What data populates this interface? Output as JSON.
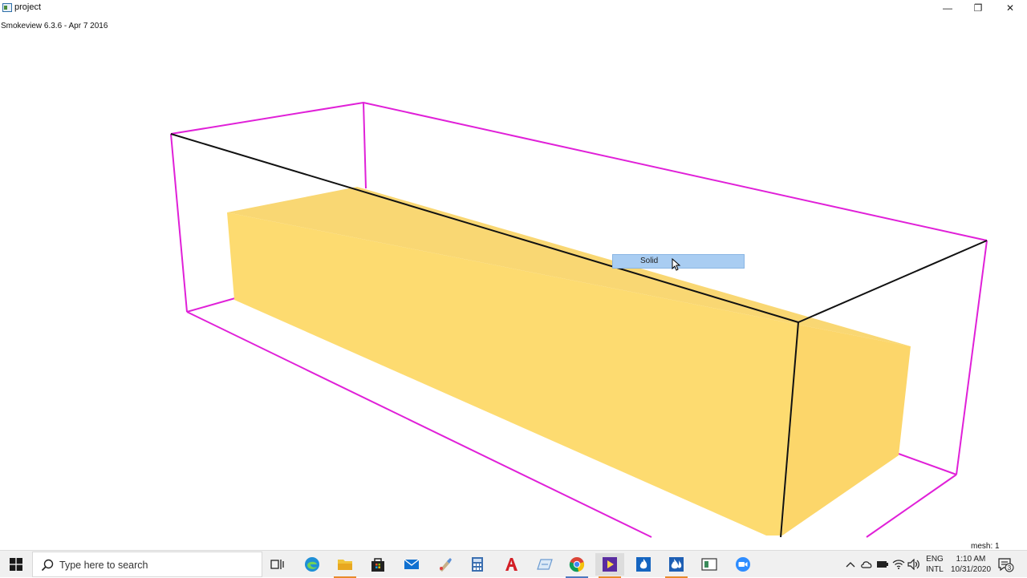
{
  "window": {
    "title": "project",
    "minimize_glyph": "—",
    "maximize_glyph": "❐",
    "close_glyph": "✕"
  },
  "viewer": {
    "version_label": "Smokeview 6.3.6 - Apr  7 2016",
    "mesh_label": "mesh: 1",
    "tooltip_text": "Solid",
    "colors": {
      "domain_outline": "#e020d8",
      "edge_line": "#111111",
      "solid_top": "#f9d773",
      "solid_front": "#fddb70",
      "solid_side": "#fcd66a"
    }
  },
  "taskbar": {
    "search_placeholder": "Type here to search",
    "pinned": [
      {
        "name": "task-view-icon"
      },
      {
        "name": "edge-icon"
      },
      {
        "name": "file-explorer-icon"
      },
      {
        "name": "store-icon"
      },
      {
        "name": "mail-icon"
      },
      {
        "name": "paint-icon"
      },
      {
        "name": "calculator-icon"
      },
      {
        "name": "autocad-icon"
      },
      {
        "name": "snip-icon"
      },
      {
        "name": "chrome-icon"
      },
      {
        "name": "media-player-icon"
      },
      {
        "name": "pyrosim-icon"
      },
      {
        "name": "smokeview-icon"
      },
      {
        "name": "window-app-icon"
      },
      {
        "name": "zoom-icon"
      }
    ],
    "tray": {
      "lang_line1": "ENG",
      "lang_line2": "INTL",
      "time": "1:10 AM",
      "date": "10/31/2020",
      "notification_count": "3"
    }
  }
}
